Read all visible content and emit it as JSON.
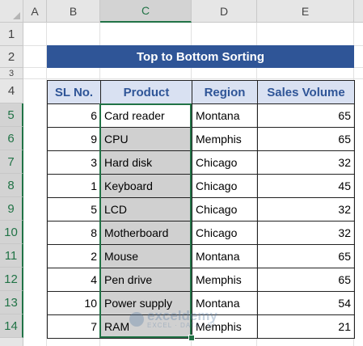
{
  "columns": [
    "A",
    "B",
    "C",
    "D",
    "E"
  ],
  "rows": [
    "1",
    "2",
    "3",
    "4",
    "5",
    "6",
    "7",
    "8",
    "9",
    "10",
    "11",
    "12",
    "13",
    "14"
  ],
  "title": "Top to Bottom Sorting",
  "table": {
    "headers": [
      "SL No.",
      "Product",
      "Region",
      "Sales Volume"
    ],
    "rows": [
      {
        "sl": "6",
        "product": "Card reader",
        "region": "Montana",
        "sales": "65"
      },
      {
        "sl": "9",
        "product": "CPU",
        "region": "Memphis",
        "sales": "65"
      },
      {
        "sl": "3",
        "product": "Hard disk",
        "region": "Chicago",
        "sales": "32"
      },
      {
        "sl": "1",
        "product": "Keyboard",
        "region": "Chicago",
        "sales": "45"
      },
      {
        "sl": "5",
        "product": "LCD",
        "region": "Chicago",
        "sales": "32"
      },
      {
        "sl": "8",
        "product": "Motherboard",
        "region": "Chicago",
        "sales": "32"
      },
      {
        "sl": "2",
        "product": "Mouse",
        "region": "Montana",
        "sales": "65"
      },
      {
        "sl": "4",
        "product": "Pen drive",
        "region": "Memphis",
        "sales": "65"
      },
      {
        "sl": "10",
        "product": "Power supply",
        "region": "Montana",
        "sales": "54"
      },
      {
        "sl": "7",
        "product": "RAM",
        "region": "Memphis",
        "sales": "21"
      }
    ]
  },
  "selection": {
    "column": "C",
    "rows": "5-14"
  },
  "watermark": {
    "main": "exceldemy",
    "sub": "EXCEL · DATA · BI"
  },
  "colors": {
    "accent": "#217346",
    "title_bg": "#2f5597",
    "header_bg": "#d9e1f2",
    "selection_fill": "#d0d0d0"
  }
}
